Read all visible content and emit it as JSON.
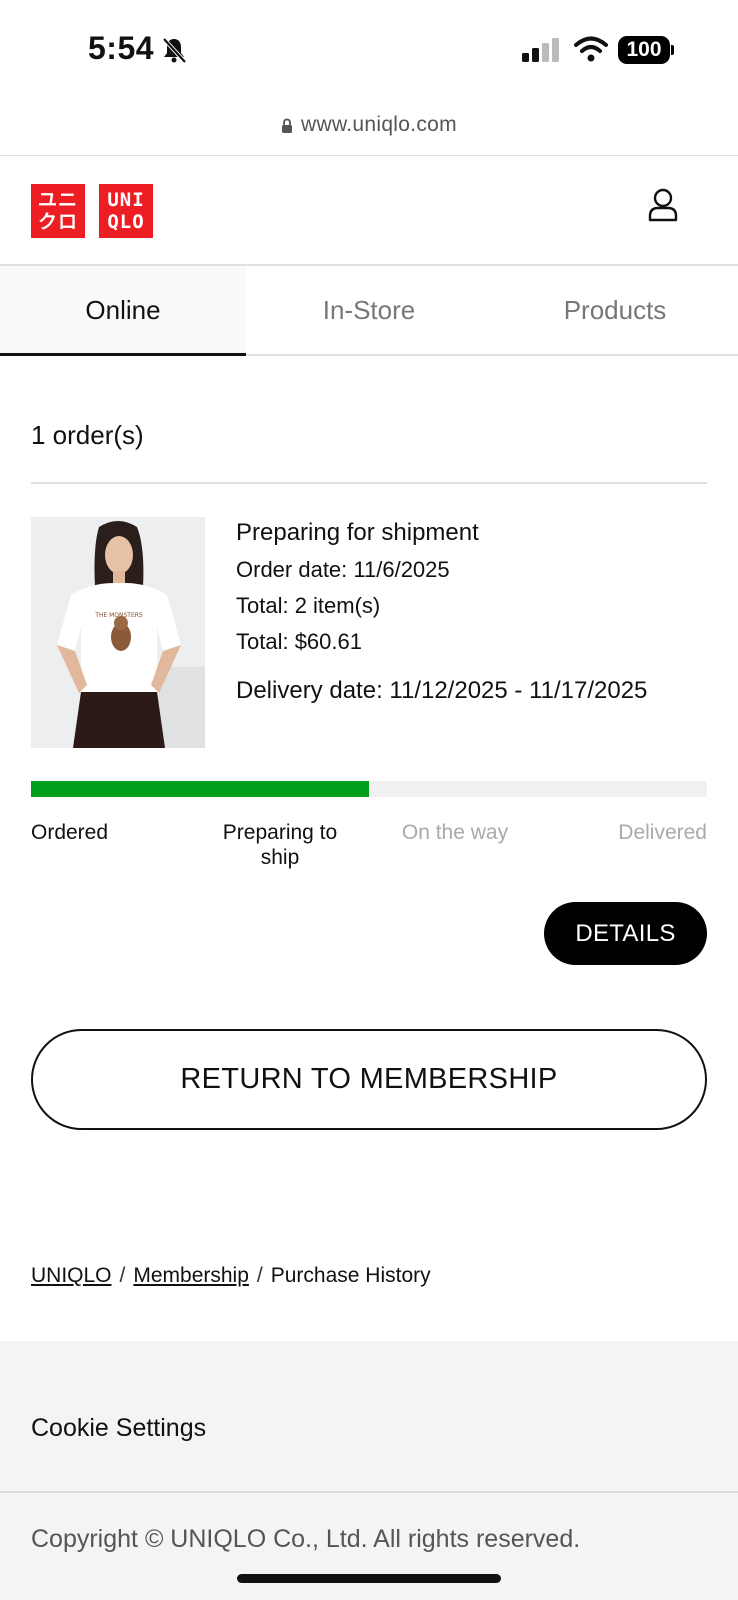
{
  "status_bar": {
    "time": "5:54",
    "battery": "100",
    "icons": [
      "bell-slash-icon",
      "signal-icon",
      "wifi-icon",
      "battery-icon"
    ]
  },
  "browser": {
    "url": "www.uniqlo.com"
  },
  "header": {
    "logo_left": [
      "ユニ",
      "クロ"
    ],
    "logo_right": [
      "UNI",
      "QLO"
    ],
    "logo_color": "#ed1d24"
  },
  "tabs": [
    {
      "label": "Online",
      "active": true
    },
    {
      "label": "In-Store",
      "active": false
    },
    {
      "label": "Products",
      "active": false
    }
  ],
  "orders": {
    "count_label": "1 order(s)",
    "items": [
      {
        "status": "Preparing for shipment",
        "order_date": "Order date: 11/6/2025",
        "items_total": "Total: 2 item(s)",
        "price_total": "Total: $60.61",
        "delivery_date": "Delivery date: 11/12/2025 - 11/17/2025",
        "progress_fraction": 0.5,
        "steps": [
          {
            "label": "Ordered",
            "done": true
          },
          {
            "label": "Preparing to ship",
            "done": true
          },
          {
            "label": "On the way",
            "done": false
          },
          {
            "label": "Delivered",
            "done": false
          }
        ],
        "details_label": "DETAILS"
      }
    ]
  },
  "colors": {
    "progress": "#00a01e",
    "button": "#000000"
  },
  "return_label": "RETURN TO MEMBERSHIP",
  "breadcrumb": {
    "items": [
      "UNIQLO",
      "Membership",
      "Purchase History"
    ],
    "separator": "/"
  },
  "footer": {
    "cookie_label": "Cookie Settings",
    "copyright": "Copyright © UNIQLO Co., Ltd. All rights reserved."
  }
}
